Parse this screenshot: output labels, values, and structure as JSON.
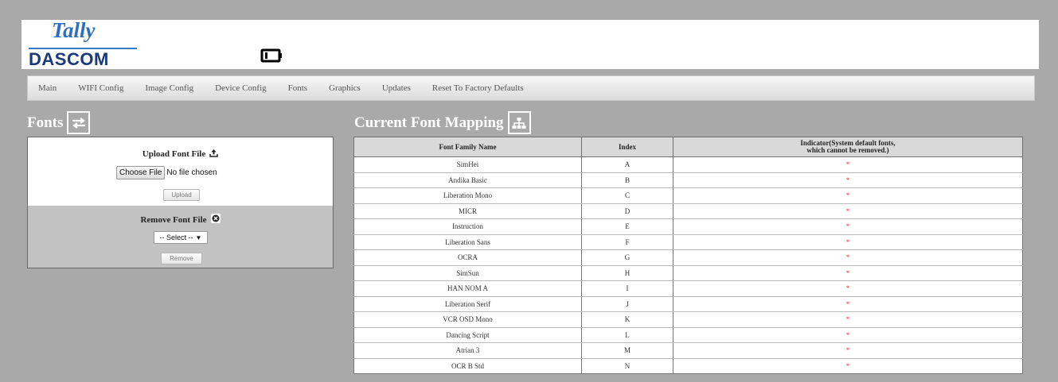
{
  "header": {
    "brand_top": "Tally",
    "brand_bottom": "DASCOM",
    "icon": "battery-icon"
  },
  "nav": {
    "items": [
      {
        "label": "Main"
      },
      {
        "label": "WIFI Config"
      },
      {
        "label": "Image Config"
      },
      {
        "label": "Device Config"
      },
      {
        "label": "Fonts"
      },
      {
        "label": "Graphics"
      },
      {
        "label": "Updates"
      },
      {
        "label": "Reset To Factory Defaults"
      }
    ]
  },
  "fonts_section": {
    "title": "Fonts",
    "icon": "swap-arrows-icon",
    "upload": {
      "heading": "Upload Font File",
      "icon": "upload-icon",
      "choose_label": "Choose File",
      "file_status": "No file chosen",
      "button_label": "Upload"
    },
    "remove": {
      "heading": "Remove Font File",
      "icon": "remove-circle-icon",
      "select_value": "-- Select --",
      "button_label": "Remove"
    }
  },
  "mapping_section": {
    "title": "Current Font Mapping",
    "icon": "sitemap-icon",
    "columns": [
      "Font Family Name",
      "Index",
      "Indicator(System default fonts,",
      "which cannot be removed.)"
    ],
    "rows": [
      {
        "name": "SimHei",
        "index": "A",
        "indicator": "*"
      },
      {
        "name": "Andika Basic",
        "index": "B",
        "indicator": "*"
      },
      {
        "name": "Liberation Mono",
        "index": "C",
        "indicator": "*"
      },
      {
        "name": "MICR",
        "index": "D",
        "indicator": "*"
      },
      {
        "name": "Instruction",
        "index": "E",
        "indicator": "*"
      },
      {
        "name": "Liberation Sans",
        "index": "F",
        "indicator": "*"
      },
      {
        "name": "OCRA",
        "index": "G",
        "indicator": "*"
      },
      {
        "name": "SimSun",
        "index": "H",
        "indicator": "*"
      },
      {
        "name": "HAN NOM A",
        "index": "I",
        "indicator": "*"
      },
      {
        "name": "Liberation Serif",
        "index": "J",
        "indicator": "*"
      },
      {
        "name": "VCR OSD Mono",
        "index": "K",
        "indicator": "*"
      },
      {
        "name": "Dancing Script",
        "index": "L",
        "indicator": "*"
      },
      {
        "name": "Atrian 3",
        "index": "M",
        "indicator": "*"
      },
      {
        "name": "OCR B Std",
        "index": "N",
        "indicator": "*"
      }
    ]
  },
  "colors": {
    "page_bg": "#a9a9a9",
    "brand_blue": "#2d6fbf",
    "brand_navy": "#1a3a7a",
    "indicator_red": "#e03030"
  }
}
